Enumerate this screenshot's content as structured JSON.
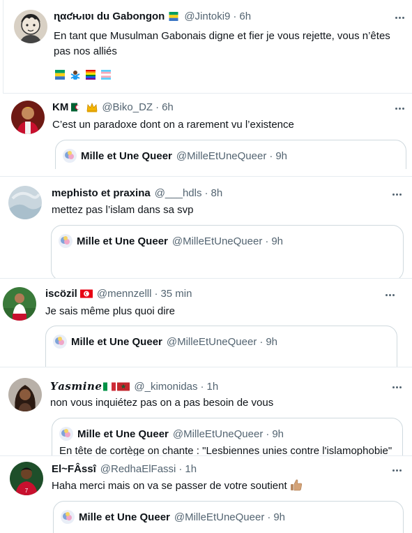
{
  "tweets": [
    {
      "name": "ɳαƈԋιʋι du Gabongon",
      "handle": "@Jintoki9",
      "time": "6h",
      "text": "En tant que Musulman Gabonais digne et fier je vous rejette, vous n’êtes pas nos alliés",
      "emoji_icons": [
        "gabon-flag-icon",
        "person-gesturing-no-icon",
        "rainbow-flag-icon",
        "trans-flag-icon"
      ],
      "flag_icon": "gabon-flag-icon"
    },
    {
      "name": "KM",
      "handle": "@Biko_DZ",
      "time": "6h",
      "text": "C’est un paradoxe dont on a rarement vu l’existence",
      "flag_icon": "algeria-flag-icon",
      "extra_icon": "crown-icon",
      "quote": {
        "name": "Mille et Une Queer",
        "handle": "@MilleEtUneQueer",
        "time": "9h"
      }
    },
    {
      "name": "mephisto et praxina",
      "handle": "@___hdls",
      "time": "8h",
      "text": "mettez pas l’islam dans sa svp",
      "quote": {
        "name": "Mille et Une Queer",
        "handle": "@MilleEtUneQueer",
        "time": "9h"
      }
    },
    {
      "name": "iscözil",
      "handle": "@mennzelll",
      "time": "35 min",
      "text": "Je sais même plus quoi dire",
      "flag_icon": "tunisia-flag-icon",
      "quote": {
        "name": "Mille et Une Queer",
        "handle": "@MilleEtUneQueer",
        "time": "9h"
      }
    },
    {
      "name": "𝒀𝒂𝒔𝒎𝒊𝒏𝒆",
      "handle": "@_kimonidas",
      "time": "1h",
      "text": "non vous inquiétez pas on a pas besoin de vous",
      "flag_icons": [
        "italy-flag-icon",
        "morocco-flag-icon"
      ],
      "quote": {
        "name": "Mille et Une Queer",
        "handle": "@MilleEtUneQueer",
        "time": "9h",
        "text": "En tête de cortège on chante : \"Lesbiennes unies contre l'islamophobie\""
      }
    },
    {
      "name": "El~FÂssî",
      "handle": "@RedhaElFassi",
      "time": "1h",
      "text": "Haha merci mais on va se passer de votre soutient",
      "text_icon": "thumbs-up-icon",
      "quote": {
        "name": "Mille et Une Queer",
        "handle": "@MilleEtUneQueer",
        "time": "9h"
      }
    }
  ],
  "colors": {
    "text": "#0f1419",
    "secondary": "#536471",
    "border": "#cfd9de",
    "divider": "#e6ecf0"
  }
}
